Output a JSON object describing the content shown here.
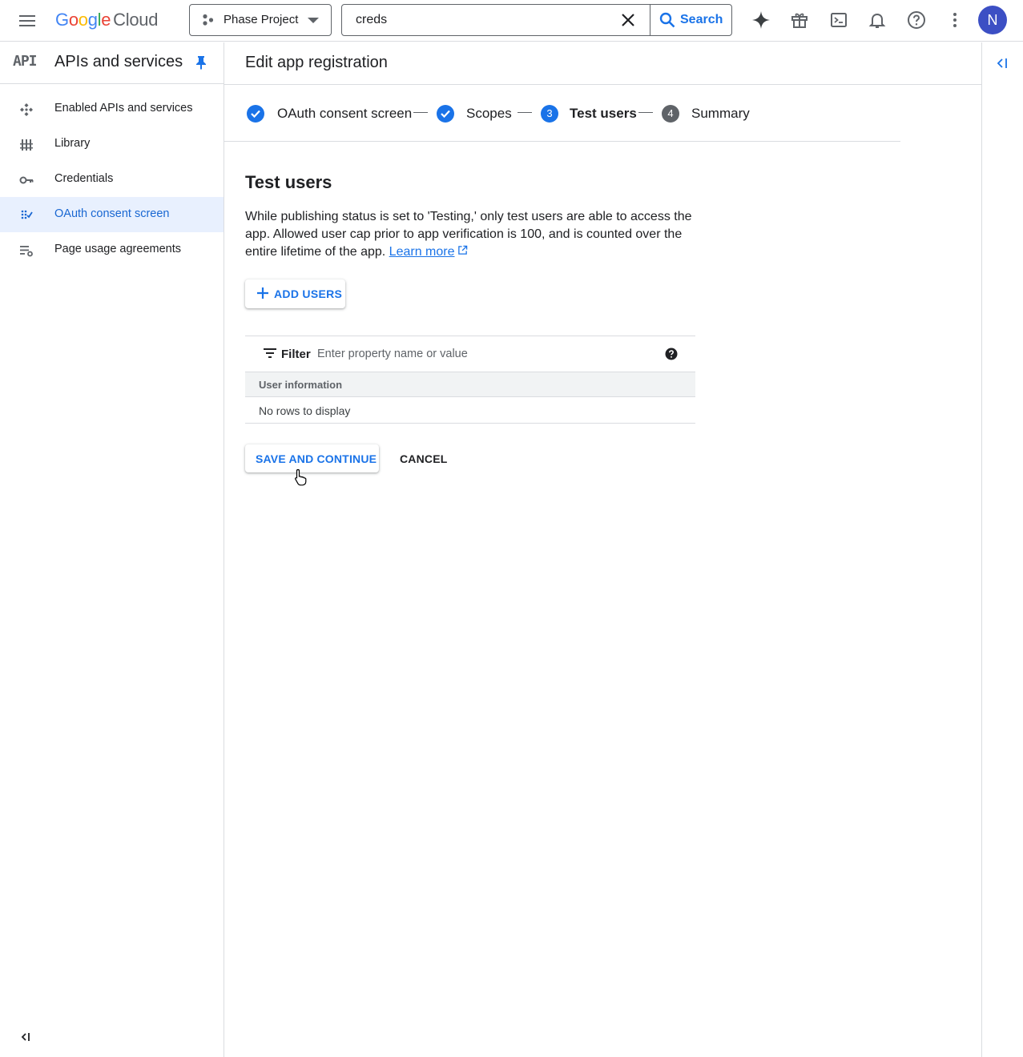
{
  "topbar": {
    "logo_google": [
      "G",
      "o",
      "o",
      "g",
      "l",
      "e"
    ],
    "logo_cloud": "Cloud",
    "project": "Phase Project",
    "search": {
      "value": "creds",
      "button_label": "Search"
    },
    "avatar_initial": "N"
  },
  "sidebar": {
    "badge": "API",
    "title": "APIs and services",
    "items": [
      {
        "label": "Enabled APIs and services",
        "icon": "enabled-apis-icon"
      },
      {
        "label": "Library",
        "icon": "library-icon"
      },
      {
        "label": "Credentials",
        "icon": "key-icon"
      },
      {
        "label": "OAuth consent screen",
        "icon": "oauth-icon",
        "active": true
      },
      {
        "label": "Page usage agreements",
        "icon": "settings-list-icon"
      }
    ]
  },
  "main": {
    "title": "Edit app registration",
    "steps": [
      {
        "label": "OAuth consent screen",
        "state": "done"
      },
      {
        "label": "Scopes",
        "state": "done"
      },
      {
        "number": "3",
        "label": "Test users",
        "state": "current"
      },
      {
        "number": "4",
        "label": "Summary",
        "state": "pending"
      }
    ],
    "section_title": "Test users",
    "description": "While publishing status is set to 'Testing,' only test users are able to access the app. Allowed user cap prior to app verification is 100, and is counted over the entire lifetime of the app.",
    "learn_more": "Learn more",
    "add_users_label": "ADD USERS",
    "filter": {
      "label": "Filter",
      "placeholder": "Enter property name or value"
    },
    "table": {
      "column": "User information",
      "empty": "No rows to display"
    },
    "save_label": "SAVE AND CONTINUE",
    "cancel_label": "CANCEL"
  },
  "colors": {
    "accent": "#1a73e8",
    "active_bg": "#e8f0fe",
    "avatar": "#3c4fc4",
    "pending_step": "#5f6368"
  }
}
